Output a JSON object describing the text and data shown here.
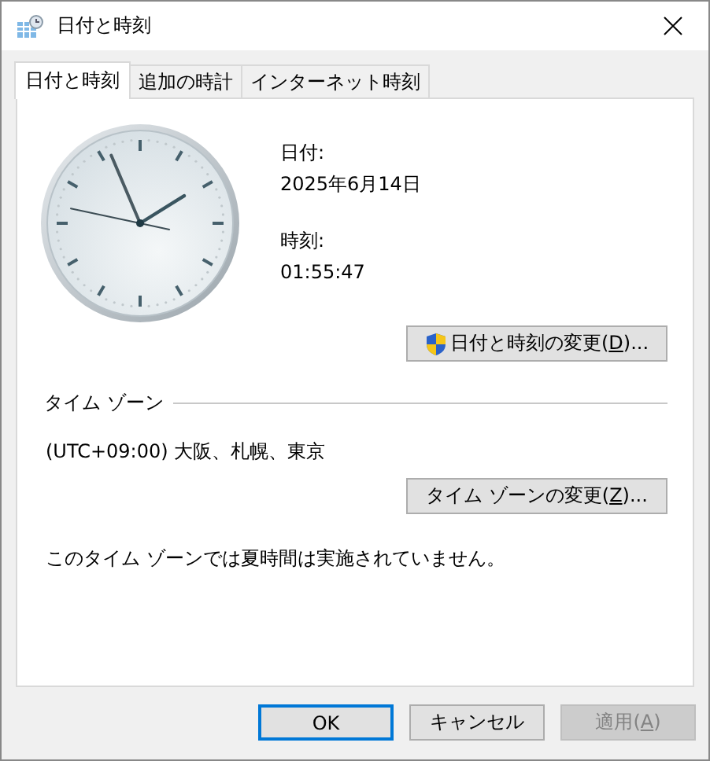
{
  "window": {
    "title": "日付と時刻"
  },
  "tabs": [
    {
      "label": "日付と時刻",
      "selected": true
    },
    {
      "label": "追加の時計",
      "selected": false
    },
    {
      "label": "インターネット時刻",
      "selected": false
    }
  ],
  "date": {
    "label": "日付:",
    "value": "2025年6月14日"
  },
  "time": {
    "label": "時刻:",
    "value": "01:55:47"
  },
  "change_datetime_button": {
    "label_before": "日付と時刻の変更(",
    "access_key": "D",
    "label_after": ")...",
    "shield": true
  },
  "time_zone": {
    "heading": "タイム ゾーン",
    "value": "(UTC+09:00) 大阪、札幌、東京"
  },
  "change_timezone_button": {
    "label_before": "タイム ゾーンの変更(",
    "access_key": "Z",
    "label_after": ")...",
    "shield": false
  },
  "dst_note": "このタイム ゾーンでは夏時間は実施されていません。",
  "buttons": [
    {
      "label_before": "OK",
      "default": true,
      "disabled": false
    },
    {
      "label_before": "キャンセル",
      "default": false,
      "disabled": false
    },
    {
      "label_before": "適用(",
      "access_key": "A",
      "label_after": ")",
      "default": false,
      "disabled": true
    }
  ]
}
